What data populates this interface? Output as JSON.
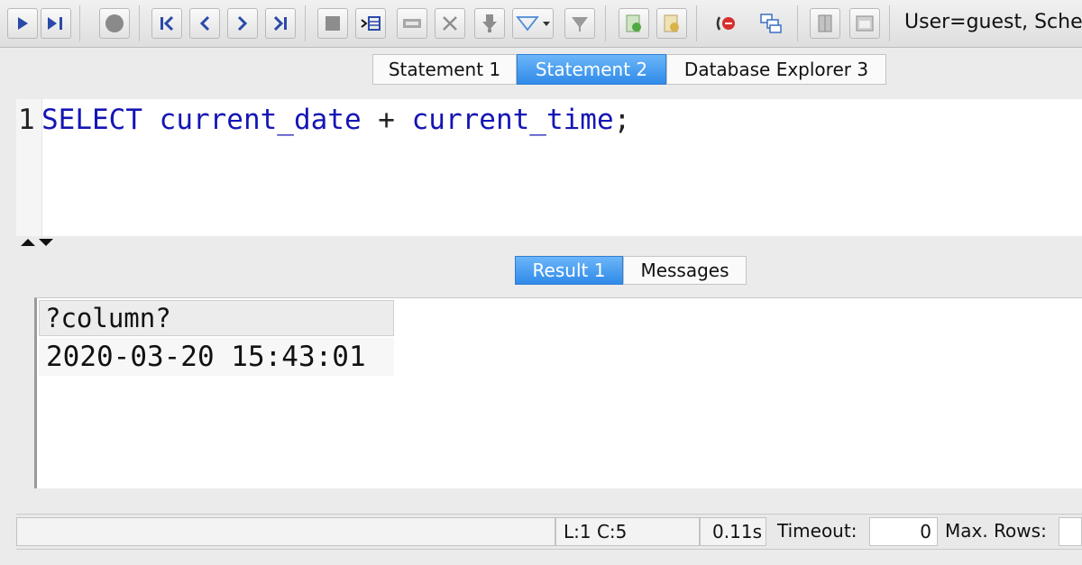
{
  "toolbar": {
    "buttons": [
      {
        "icon": "execute-icon"
      },
      {
        "icon": "execute-step-icon"
      },
      {
        "icon": "stop-icon"
      },
      {
        "icon": "first-row-icon"
      },
      {
        "icon": "previous-row-icon"
      },
      {
        "icon": "next-row-icon"
      },
      {
        "icon": "last-row-icon"
      },
      {
        "icon": "stop-query-icon"
      },
      {
        "icon": "insert-row-icon"
      },
      {
        "icon": "copy-row-icon"
      },
      {
        "icon": "delete-row-icon"
      },
      {
        "icon": "save-icon"
      },
      {
        "icon": "filter-icon"
      },
      {
        "icon": "clear-filter-icon"
      },
      {
        "icon": "commit-icon"
      },
      {
        "icon": "rollback-icon"
      },
      {
        "icon": "disconnect-icon"
      },
      {
        "icon": "connection-icon"
      },
      {
        "icon": "object-icon"
      },
      {
        "icon": "window-icon"
      }
    ],
    "user_info": "User=guest, Schema"
  },
  "tabs": [
    {
      "label": "Statement 1",
      "active": false
    },
    {
      "label": "Statement 2",
      "active": true
    },
    {
      "label": "Database Explorer 3",
      "active": false
    }
  ],
  "editor": {
    "line_number": "1",
    "keyword": "SELECT",
    "identifier1": "current_date",
    "operator": "+",
    "identifier2": "current_time",
    "terminator": ";"
  },
  "result_tabs": [
    {
      "label": "Result 1",
      "active": true
    },
    {
      "label": "Messages",
      "active": false
    }
  ],
  "result": {
    "columns": [
      "?column?"
    ],
    "rows": [
      [
        "2020-03-20 15:43:01"
      ]
    ]
  },
  "statusbar": {
    "cursor": "L:1 C:5",
    "elapsed": "0.11s",
    "timeout_label": "Timeout:",
    "timeout_value": "0",
    "maxrows_label": "Max. Rows:"
  },
  "colors": {
    "active_tab": "#3d94ee",
    "sql_keyword": "#1515b5"
  }
}
